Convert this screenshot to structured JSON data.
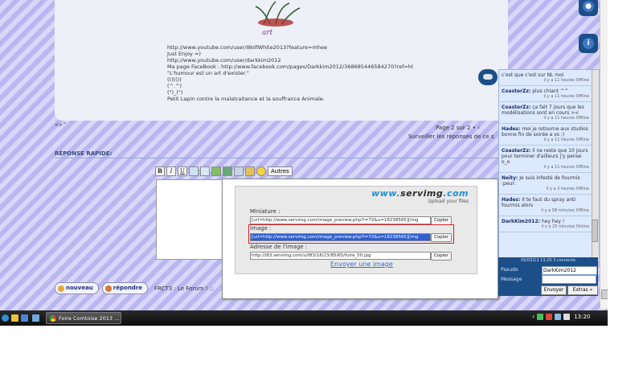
{
  "post": {
    "signature_lines": [
      "http://www.youtube.com/user/WolfWhite2013?feature=mhee",
      "Just Enjoy =)",
      "http://www.youtube.com/user/darkkim2012",
      "Ma page FaceBook : http://www.facebook.com/pages/Darkkim2012/368685446584270?ref=hl",
      "\"L'humour est un art d'exister.\"",
      "(()(())",
      "(^.^)",
      "(\")_(\")",
      "Petit Lapin contre la malatraitance et la souffrance Animale."
    ]
  },
  "pager": {
    "top_left": "<>^",
    "page_info": "Page 2 sur 2 • ‹",
    "watch": "Surveiller les réponses de ce s",
    "bottom": "Page 2 sur 2"
  },
  "quick_reply": {
    "title": "RÉPONSE RAPIDE:",
    "toolbar": {
      "bold": "B",
      "italic": "I",
      "underline": "U",
      "others": "Autres"
    }
  },
  "buttons": {
    "new": "nouveau",
    "reply": "répondre",
    "forum": "FRCT3 : Le Forum ! ::"
  },
  "servimg": {
    "logo_prefix": "www.",
    "logo_brand": "servimg",
    "logo_suffix": ".com",
    "tagline": "Upload your files",
    "thumb_label": "Miniature :",
    "thumb_value": "[url=http://www.servimg.com/image_preview.php?i=72&u=18238565][img",
    "image_label": "Image :",
    "image_value": "[url=http://www.servimg.com/image_preview.php?i=72&u=18238565][img",
    "address_label": "Adresse de l'image :",
    "address_value": "http://i83.servimg.com/u/f83/18/23/85/65/foire_50.jpg",
    "copy": "Copier",
    "send": "Envoyer une image"
  },
  "chat": {
    "messages": [
      {
        "user": "",
        "text": "c'est que c'est sur NL moi",
        "time": "il y a 11 heures Offline"
      },
      {
        "user": "CoasterZz:",
        "text": "plus chiant ^^",
        "time": "il y a 11 heures Offline"
      },
      {
        "user": "CoasterZz:",
        "text": "ça fait 7 jours que les modélisations sont en cours ><",
        "time": "il y a 11 heures Offline"
      },
      {
        "user": "Hades:",
        "text": "moi je retourne aux studios bonne fin de soirée a vs :)",
        "time": "il y a 11 heures Offline"
      },
      {
        "user": "CoasterZz:",
        "text": "il ne reste que 10 jours pour terminer d'ailleurs j'y pense o_o",
        "time": "il y a 11 heures Offline"
      },
      {
        "user": "Neity:",
        "text": "Je suis infesté de fourmis :peur:",
        "time": "il y a 2 heures Offline"
      },
      {
        "user": "Hades:",
        "text": "Il te faut du spray anti fourmis alors",
        "time": "il y a 58 minutes Offline"
      },
      {
        "user": "DarkKim2012:",
        "text": "hey hey !",
        "time": "il y a 25 minutes Online"
      }
    ],
    "date": "05/03/13 13:20 3 connecté",
    "user_label": "Pseudo",
    "msg_label": "Message",
    "username": "DarkKim2012",
    "send": "Envoyer",
    "extras": "Extras »"
  },
  "taskbar": {
    "item": "Foire Comtoise 2013 ...",
    "clock": "13:20",
    "tray_arrow": "‹"
  }
}
